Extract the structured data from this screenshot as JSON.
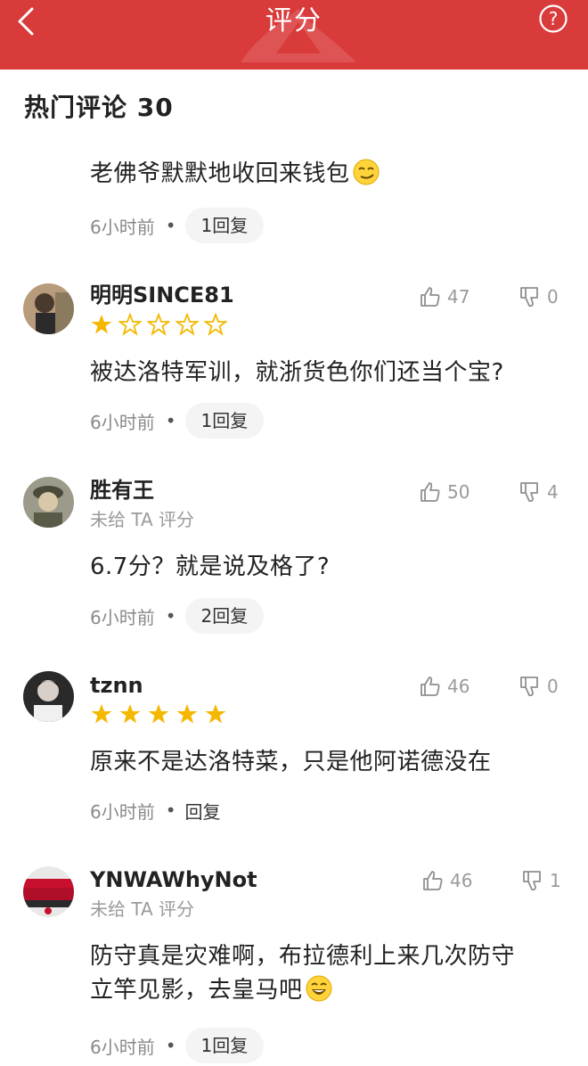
{
  "header": {
    "title": "评分"
  },
  "section": {
    "title": "热门评论 30"
  },
  "comments": [
    {
      "text": "老佛爷默默地收回来钱包",
      "time": "6小时前",
      "reply": "1回复"
    },
    {
      "username": "明明SINCE81",
      "rating": 1,
      "likes": "47",
      "dislikes": "0",
      "text": "被达洛特军训，就浙货色你们还当个宝?",
      "time": "6小时前",
      "reply": "1回复"
    },
    {
      "username": "胜有王",
      "subtitle": "未给 TA 评分",
      "likes": "50",
      "dislikes": "4",
      "text": "6.7分？就是说及格了?",
      "time": "6小时前",
      "reply": "2回复"
    },
    {
      "username": "tznn",
      "rating": 5,
      "likes": "46",
      "dislikes": "0",
      "text": "原来不是达洛特菜，只是他阿诺德没在",
      "time": "6小时前",
      "reply": "回复"
    },
    {
      "username": "YNWAWhyNot",
      "subtitle": "未给 TA 评分",
      "likes": "46",
      "dislikes": "1",
      "text_line1": "防守真是灾难啊，布拉德利上来几次防守",
      "text_line2": "立竿见影，去皇马吧",
      "time": "6小时前",
      "reply": "1回复"
    }
  ],
  "colors": {
    "header_bg": "#d93a3a",
    "star_filled": "#f5b800",
    "star_empty": "#f5b800"
  },
  "icons": [
    "back-chevron-icon",
    "help-icon",
    "thumb-up-icon",
    "thumb-down-icon",
    "star-icon",
    "smirk-emoji-icon",
    "laugh-emoji-icon"
  ]
}
